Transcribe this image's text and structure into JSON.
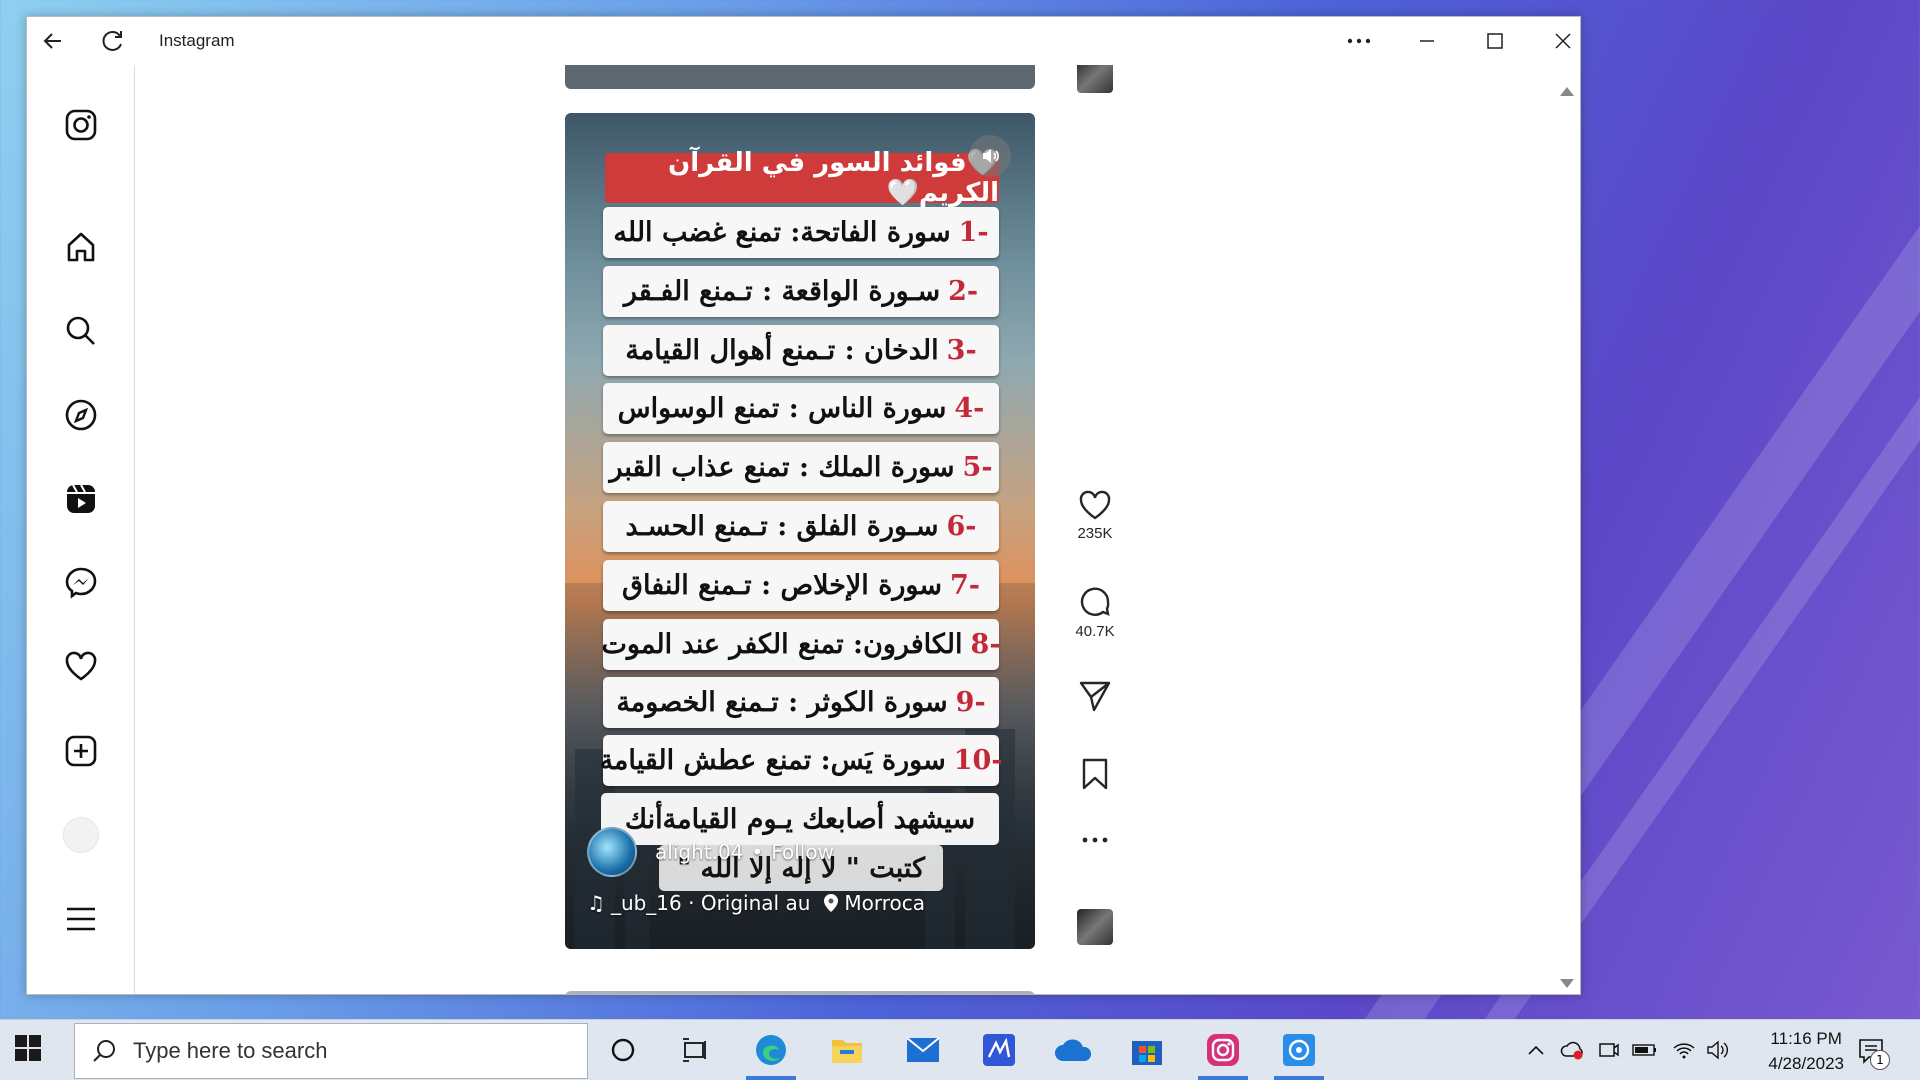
{
  "window": {
    "title": "Instagram"
  },
  "reel": {
    "header": "🤍فوائد السور في القرآن الكريم🤍",
    "rows": [
      {
        "num": "-1",
        "text": "سورة الفاتحة: تمنع غضب الله"
      },
      {
        "num": "-2",
        "text": "سـورة الواقعة : تـمنع الفـقر"
      },
      {
        "num": "-3",
        "text": "الدخان : تـمنع أهوال القيامة"
      },
      {
        "num": "-4",
        "text": "سورة الناس : تمنع الوسواس"
      },
      {
        "num": "-5",
        "text": "سورة الملك : تمنع عذاب القبر"
      },
      {
        "num": "-6",
        "text": "سـورة الفلق : تـمنع الحسـد"
      },
      {
        "num": "-7",
        "text": "سورة الإخلاص : تـمنع النفاق"
      },
      {
        "num": "-8",
        "text": "الكافرون: تمنع الكفر عند الموت"
      },
      {
        "num": "-9",
        "text": "سورة الكوثر : تـمنع الخصومة"
      },
      {
        "num": "-10",
        "text": "سورة يَس: تمنع عطش القيامة"
      }
    ],
    "tail_line1": "سيشهد أصابعك يـوم القيامةأنك",
    "tail_line2": "كتبت \" لا إله إلا الله \"",
    "author": "alight.04",
    "dot": "•",
    "follow": "Follow",
    "audio": "_ub_16 · Original au",
    "location": "Morroca"
  },
  "actions": {
    "likes": "235K",
    "comments": "40.7K"
  },
  "taskbar": {
    "search_placeholder": "Type here to search",
    "time": "11:16 PM",
    "date": "4/28/2023",
    "notification_count": "1"
  },
  "icons": {
    "back": "back-arrow-icon",
    "refresh": "refresh-icon",
    "more": "more-icon",
    "minimize": "minimize-icon",
    "maximize": "maximize-icon",
    "close": "close-icon"
  },
  "colors": {
    "accent_red": "#cf3a3a",
    "number_red": "#c22a3a",
    "taskbar_active": "#3b7ad9"
  }
}
